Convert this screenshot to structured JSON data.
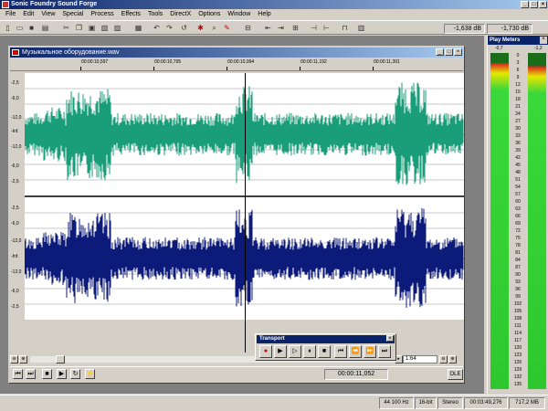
{
  "app": {
    "title": "Sonic Foundry Sound Forge",
    "min": "_",
    "max": "□",
    "close": "×"
  },
  "menu": [
    "File",
    "Edit",
    "View",
    "Special",
    "Process",
    "Effects",
    "Tools",
    "DirectX",
    "Options",
    "Window",
    "Help"
  ],
  "toolbar": {
    "level_left": "-1,638 dB",
    "level_right": "-1,730 dB"
  },
  "document": {
    "title": "Музыкальное оборудование.wav",
    "ruler": [
      "00:00:10,597",
      "00:00:10,795",
      "00:00:10,994",
      "00:00:11,192",
      "00:00:11,391"
    ],
    "db_top": [
      "-2,5",
      "-6,0",
      "-12,0",
      "-Inf.",
      "-12,0",
      "-6,0",
      "-2,5"
    ],
    "db_bottom": [
      "-2,5",
      "-6,0",
      "-12,0",
      "-Inf.",
      "-12,0",
      "-6,0",
      "-2,5"
    ],
    "zoom": "1:64",
    "position": "00:00:11,052",
    "ole": "OLE",
    "colors": {
      "left_channel": "#1a9e7a",
      "right_channel": "#0c1a7a"
    }
  },
  "transport": {
    "title": "Transport",
    "close": "×",
    "buttons": [
      "record",
      "play-all",
      "play",
      "pause",
      "stop",
      "go-to-start",
      "rewind",
      "fast-forward",
      "go-to-end"
    ]
  },
  "meters": {
    "title": "Play Meters",
    "close": "×",
    "peak_left": "-0,7",
    "peak_right": "-1,2",
    "level_left": 0.97,
    "level_right": 0.96,
    "scale": [
      "0",
      "3",
      "6",
      "9",
      "12",
      "15",
      "18",
      "21",
      "24",
      "27",
      "30",
      "33",
      "36",
      "39",
      "42",
      "45",
      "48",
      "51",
      "54",
      "57",
      "60",
      "63",
      "66",
      "69",
      "72",
      "75",
      "78",
      "81",
      "84",
      "87",
      "90",
      "93",
      "96",
      "99",
      "102",
      "105",
      "108",
      "111",
      "114",
      "117",
      "120",
      "123",
      "126",
      "129",
      "132",
      "135"
    ]
  },
  "status": {
    "rate": "44 100 Hz",
    "bits": "16-bit",
    "channels": "Stereo",
    "length": "00:03:49,276",
    "free": "717,2 MB"
  }
}
